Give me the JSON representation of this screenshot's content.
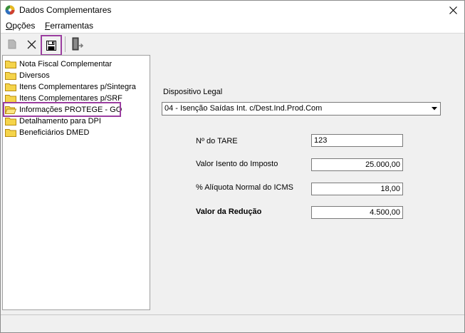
{
  "window": {
    "title": "Dados Complementares"
  },
  "menu": [
    {
      "label_underlined": "O",
      "label_rest": "pções"
    },
    {
      "label_underlined": "F",
      "label_rest": "erramentas"
    }
  ],
  "toolbar": {
    "new_icon": "document-icon",
    "delete_icon": "x-icon",
    "save_icon": "floppy-disk-icon",
    "exit_icon": "door-exit-icon"
  },
  "tree": {
    "items": [
      {
        "label": "Nota Fiscal Complementar"
      },
      {
        "label": "Diversos"
      },
      {
        "label": "Itens Complementares p/Sintegra"
      },
      {
        "label": "Itens Complementares p/SRF"
      },
      {
        "label": "Informações PROTEGE - GO"
      },
      {
        "label": "Detalhamento para DPI"
      },
      {
        "label": "Beneficiários DMED"
      }
    ],
    "selected": "Informações PROTEGE - GO"
  },
  "form": {
    "dispositivo_label": "Dispositivo Legal",
    "dispositivo_value": "04 - Isenção Saídas Int. c/Dest.Ind.Prod.Com",
    "tare_label": "Nº do TARE",
    "tare_value": "123",
    "valor_isento_label": "Valor Isento do Imposto",
    "valor_isento_value": "25.000,00",
    "aliquota_label": "% Alíquota Normal do ICMS",
    "aliquota_value": "18,00",
    "reducao_label": "Valor da Redução",
    "reducao_value": "4.500,00"
  },
  "colors": {
    "highlight": "#9b3ea0",
    "folder": "#f5d44a",
    "folder_border": "#b88b10"
  }
}
